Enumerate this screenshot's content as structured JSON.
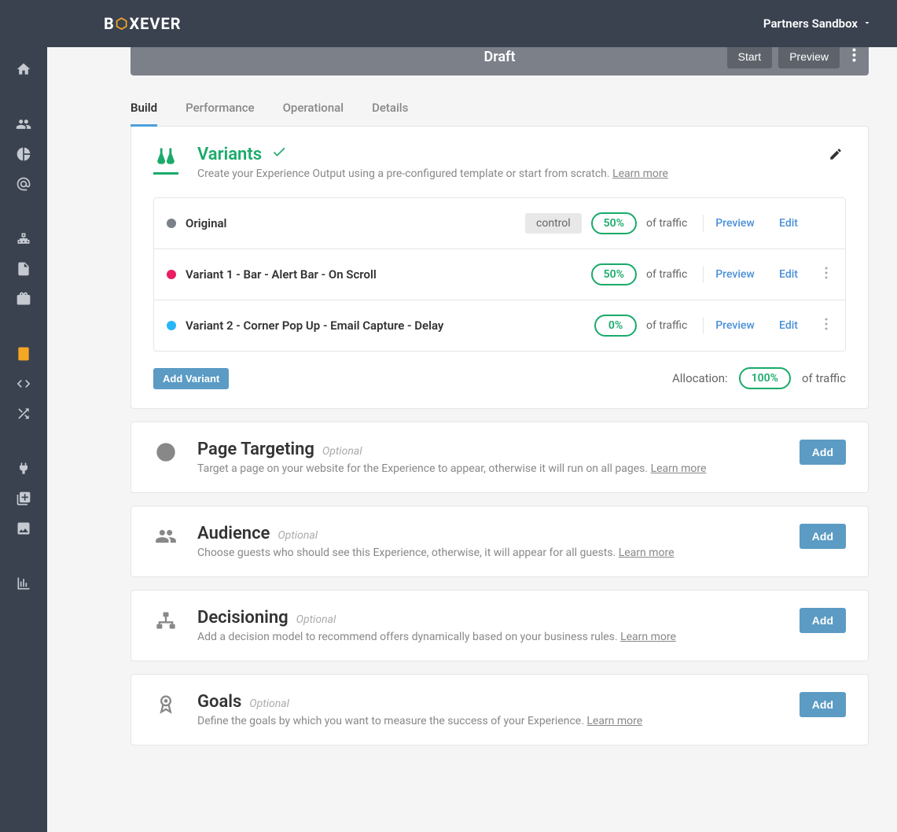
{
  "header": {
    "logo_pre": "B",
    "logo_post": "XEVER",
    "tenant": "Partners Sandbox"
  },
  "status": {
    "label": "Draft",
    "start": "Start",
    "preview": "Preview"
  },
  "tabs": [
    {
      "label": "Build",
      "active": true
    },
    {
      "label": "Performance",
      "active": false
    },
    {
      "label": "Operational",
      "active": false
    },
    {
      "label": "Details",
      "active": false
    }
  ],
  "variants": {
    "title": "Variants",
    "subtitle": "Create your Experience Output using a pre-configured template or start from scratch.",
    "learn": "Learn more",
    "rows": [
      {
        "name": "Original",
        "control": "control",
        "percent": "50%",
        "color": "#7b8089",
        "has_more": false
      },
      {
        "name": "Variant 1 - Bar - Alert Bar -  On Scroll",
        "control": "",
        "percent": "50%",
        "color": "#e91e63",
        "has_more": true
      },
      {
        "name": "Variant 2 - Corner Pop Up - Email Capture - Delay",
        "control": "",
        "percent": "0%",
        "color": "#29b6f6",
        "has_more": true
      }
    ],
    "of_traffic": "of traffic",
    "preview": "Preview",
    "edit": "Edit",
    "add_variant": "Add Variant",
    "allocation_label": "Allocation:",
    "allocation_pct": "100%"
  },
  "sections": {
    "page_targeting": {
      "title": "Page Targeting",
      "sub": "Target a page on your website for the Experience to appear, otherwise it will run on all pages."
    },
    "audience": {
      "title": "Audience",
      "sub": "Choose guests who should see this Experience, otherwise, it will appear for all guests."
    },
    "decisioning": {
      "title": "Decisioning",
      "sub": "Add a decision model to recommend offers dynamically based on your business rules."
    },
    "goals": {
      "title": "Goals",
      "sub": "Define the goals by which you want to measure the success of your Experience."
    }
  },
  "common": {
    "optional": "Optional",
    "learn": "Learn more",
    "add": "Add"
  }
}
